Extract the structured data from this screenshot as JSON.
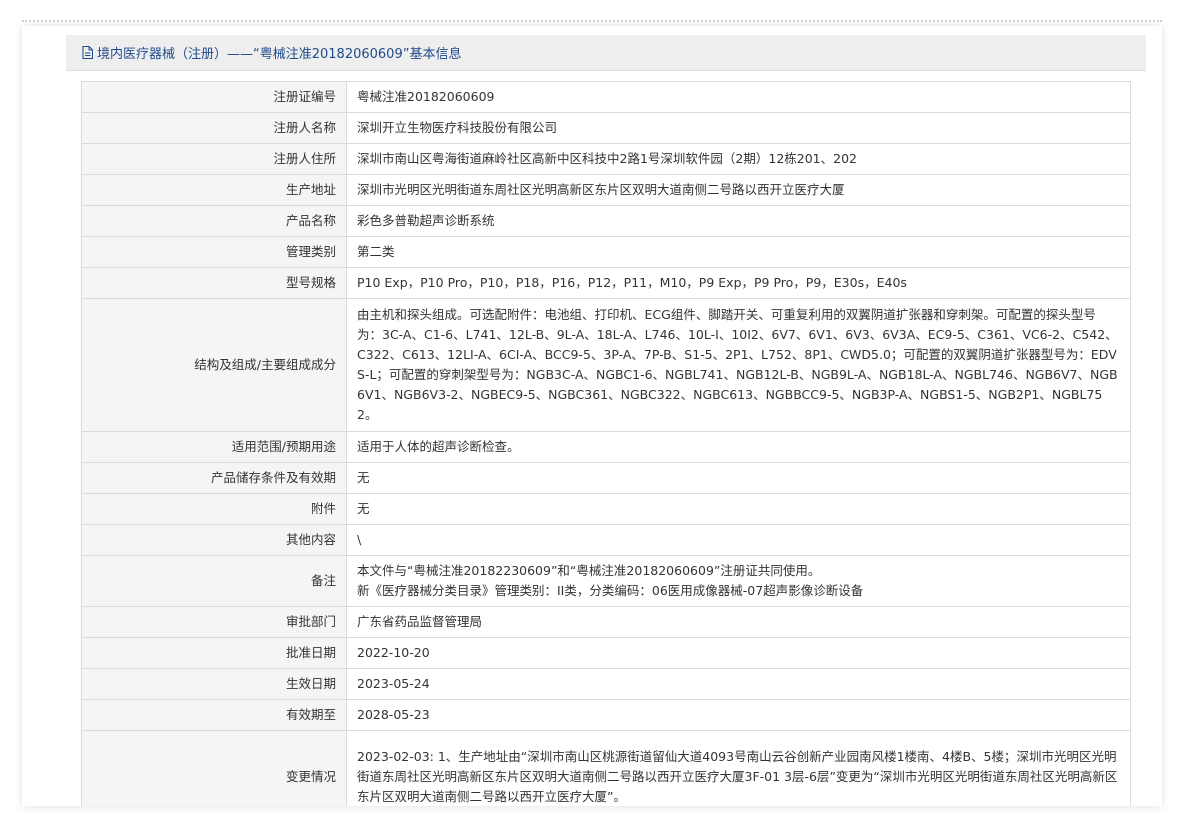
{
  "header": {
    "title": "境内医疗器械（注册）——“粤械注准20182060609”基本信息",
    "icon": "document-icon"
  },
  "rows": [
    {
      "label": "注册证编号",
      "value": "粤械注准20182060609"
    },
    {
      "label": "注册人名称",
      "value": "深圳开立生物医疗科技股份有限公司"
    },
    {
      "label": "注册人住所",
      "value": "深圳市南山区粤海街道麻岭社区高新中区科技中2路1号深圳软件园（2期）12栋201、202"
    },
    {
      "label": "生产地址",
      "value": "深圳市光明区光明街道东周社区光明高新区东片区双明大道南侧二号路以西开立医疗大厦"
    },
    {
      "label": "产品名称",
      "value": "彩色多普勒超声诊断系统"
    },
    {
      "label": "管理类别",
      "value": "第二类"
    },
    {
      "label": "型号规格",
      "value": "P10 Exp，P10 Pro，P10，P18，P16，P12，P11，M10，P9 Exp，P9 Pro，P9，E30s，E40s"
    },
    {
      "label": "结构及组成/主要组成成分",
      "value": "由主机和探头组成。可选配附件：电池组、打印机、ECG组件、脚踏开关、可重复利用的双翼阴道扩张器和穿刺架。可配置的探头型号为：3C-A、C1-6、L741、12L-B、9L-A、18L-A、L746、10L-I、10I2、6V7、6V1、6V3、6V3A、EC9-5、C361、VC6-2、C542、C322、C613、12LI-A、6CI-A、BCC9-5、3P-A、7P-B、S1-5、2P1、L752、8P1、CWD5.0；可配置的双翼阴道扩张器型号为：EDVS-L；可配置的穿刺架型号为：NGB3C-A、NGBC1-6、NGBL741、NGB12L-B、NGB9L-A、NGB18L-A、NGBL746、NGB6V7、NGB6V1、NGB6V3-2、NGBEC9-5、NGBC361、NGBC322、NGBC613、NGBBCC9-5、NGB3P-A、NGBS1-5、NGB2P1、NGBL752。"
    },
    {
      "label": "适用范围/预期用途",
      "value": "适用于人体的超声诊断检查。"
    },
    {
      "label": "产品储存条件及有效期",
      "value": "无"
    },
    {
      "label": "附件",
      "value": "无"
    },
    {
      "label": "其他内容",
      "value": "\\"
    },
    {
      "label": "备注",
      "value": "本文件与“粤械注准20182230609”和“粤械注准20182060609”注册证共同使用。",
      "value2": "新《医疗器械分类目录》管理类别：II类，分类编码：06医用成像器械-07超声影像诊断设备"
    },
    {
      "label": "审批部门",
      "value": "广东省药品监督管理局"
    },
    {
      "label": "批准日期",
      "value": "2022-10-20"
    },
    {
      "label": "生效日期",
      "value": "2023-05-24"
    },
    {
      "label": "有效期至",
      "value": "2028-05-23"
    },
    {
      "label": "变更情况",
      "value": "2023-02-03: 1、生产地址由“深圳市南山区桃源街道留仙大道4093号南山云谷创新产业园南风楼1楼南、4楼B、5楼；深圳市光明区光明街道东周社区光明高新区东片区双明大道南侧二号路以西开立医疗大厦3F-01 3层-6层”变更为“深圳市光明区光明街道东周社区光明高新区东片区双明大道南侧二号路以西开立医疗大厦”。"
    }
  ],
  "colors": {
    "title_text": "#1f4b8c",
    "title_bg": "#eeeeee",
    "label_bg": "#f5f5f5",
    "border": "#dadada"
  }
}
